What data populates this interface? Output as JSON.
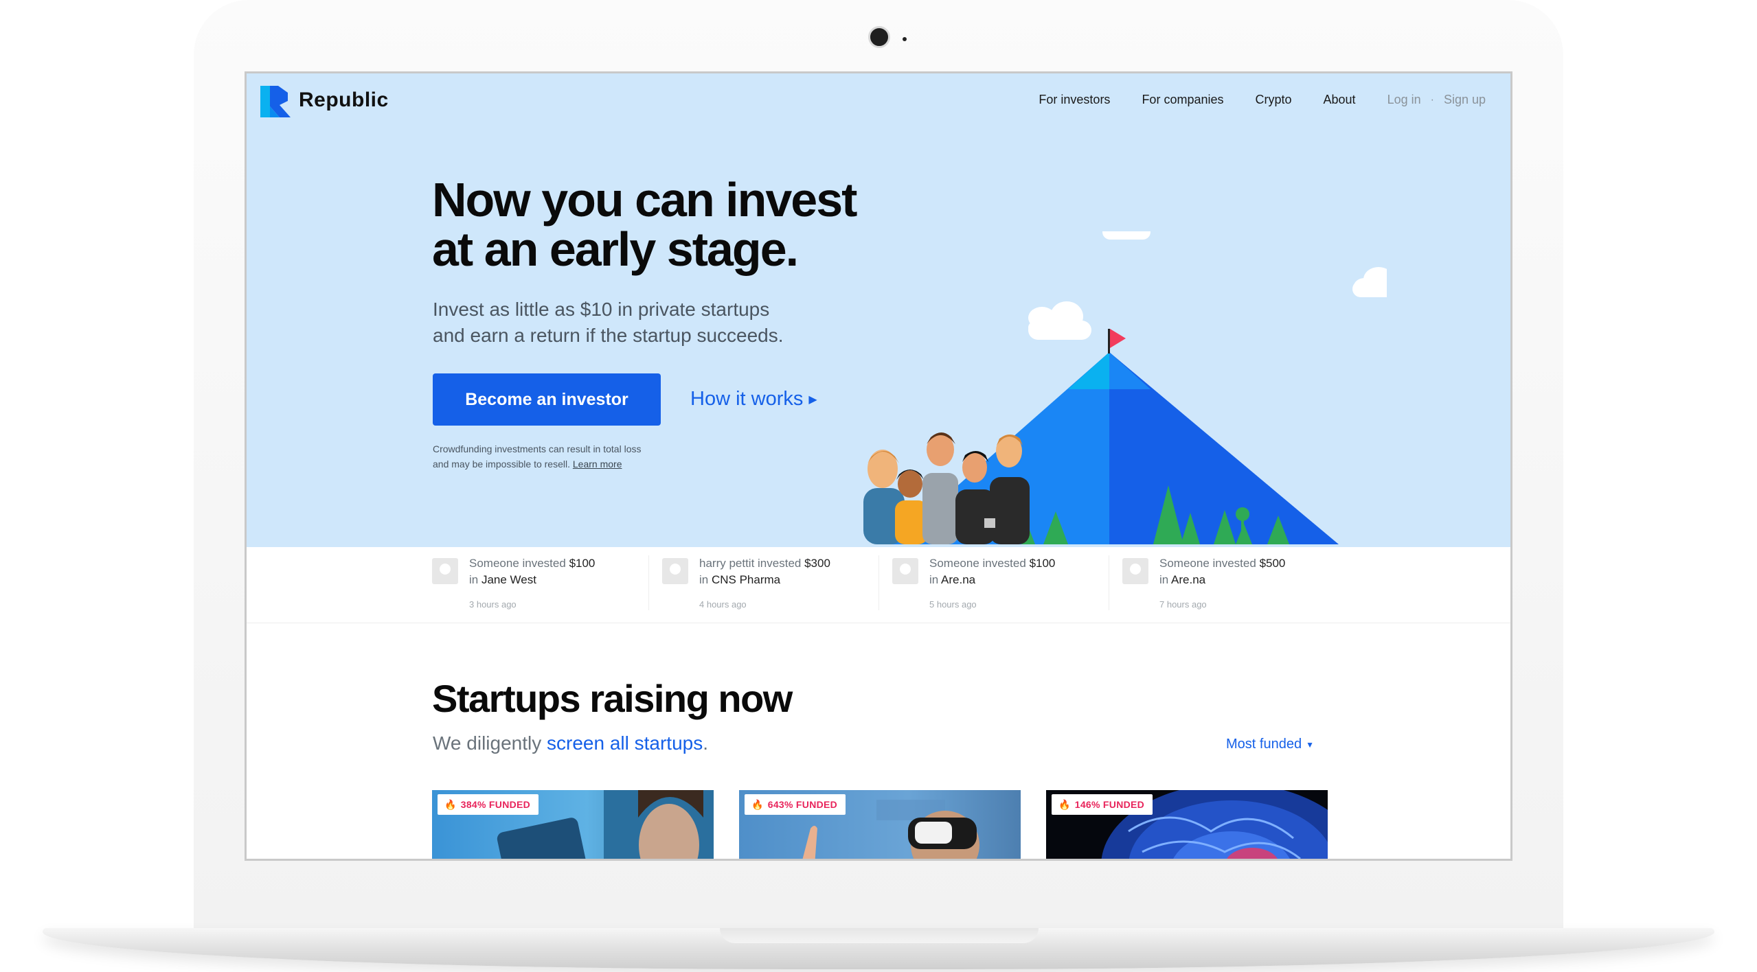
{
  "brand": {
    "name": "Republic"
  },
  "nav": {
    "items": [
      "For investors",
      "For companies",
      "Crypto",
      "About"
    ],
    "login": "Log in",
    "separator": "·",
    "signup": "Sign up"
  },
  "hero": {
    "title_line1": "Now you can invest",
    "title_line2": "at an early stage.",
    "subtitle_line1": "Invest as little as $10 in private startups",
    "subtitle_line2": "and earn a return if the startup succeeds.",
    "cta": "Become an investor",
    "secondary_link": "How it works",
    "disclaimer_line1": "Crowdfunding investments can result in total loss",
    "disclaimer_line2": "and may be impossible to resell.",
    "disclaimer_link": "Learn more"
  },
  "feed": [
    {
      "who": "Someone invested",
      "amount": "$100",
      "in": "in",
      "company": "Jane West",
      "time": "3 hours ago"
    },
    {
      "who": "harry pettit invested",
      "amount": "$300",
      "in": "in",
      "company": "CNS Pharma",
      "time": "4 hours ago"
    },
    {
      "who": "Someone invested",
      "amount": "$100",
      "in": "in",
      "company": "Are.na",
      "time": "5 hours ago"
    },
    {
      "who": "Someone invested",
      "amount": "$500",
      "in": "in",
      "company": "Are.na",
      "time": "7 hours ago"
    }
  ],
  "startups": {
    "title": "Startups raising now",
    "subtitle_prefix": "We diligently",
    "subtitle_link": "screen all startups",
    "subtitle_suffix": ".",
    "sort_label": "Most funded",
    "cards": [
      {
        "badge": "384% FUNDED"
      },
      {
        "badge": "643% FUNDED"
      },
      {
        "badge": "146% FUNDED"
      }
    ]
  },
  "colors": {
    "hero_bg": "#cfe7fb",
    "accent": "#1560e8",
    "badge_text": "#e8245b",
    "mountain": "#1877f2"
  }
}
